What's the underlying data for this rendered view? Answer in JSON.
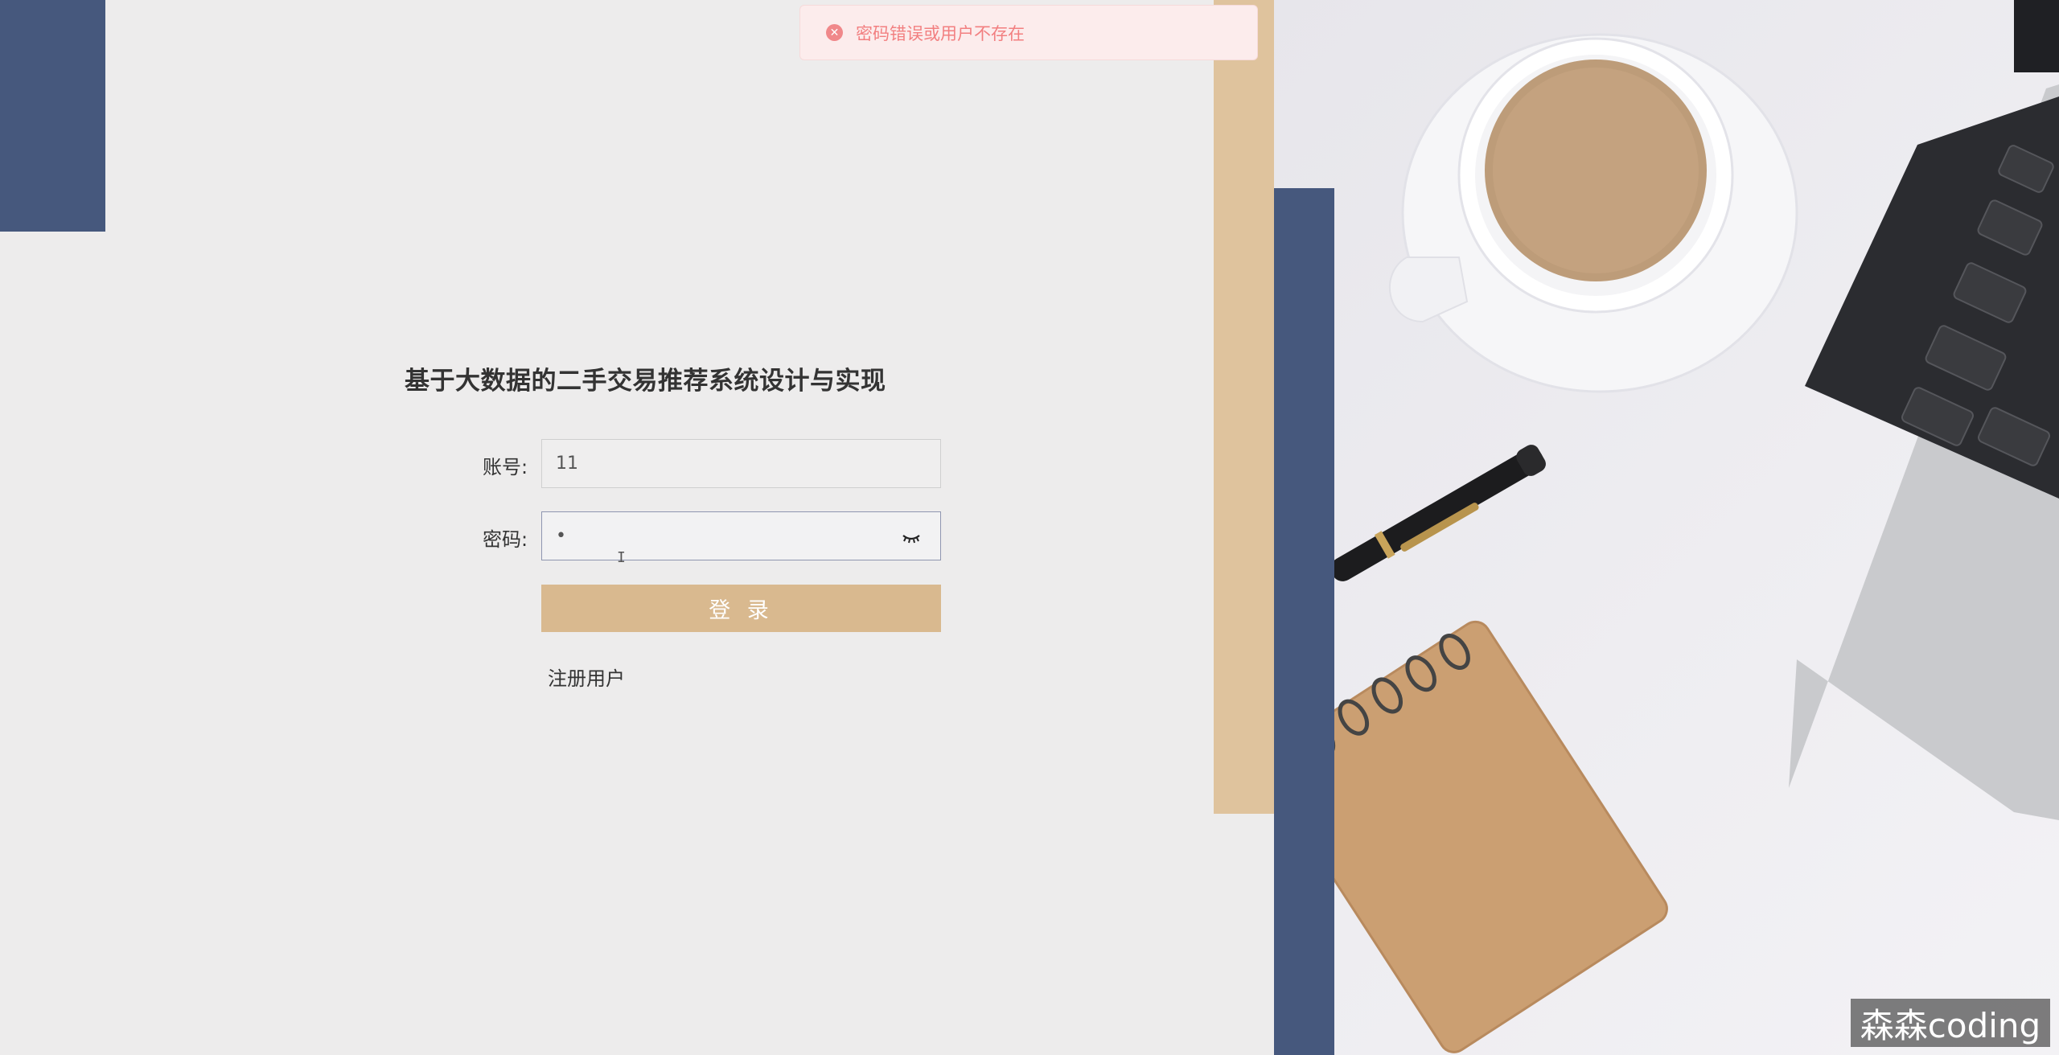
{
  "toast": {
    "message": "密码错误或用户不存在",
    "icon": "error-circle-icon",
    "color": "#f27f80"
  },
  "login": {
    "title": "基于大数据的二手交易推荐系统设计与实现",
    "username_label": "账号:",
    "username_value": "11",
    "password_label": "密码:",
    "password_value": "•",
    "login_button": "登 录",
    "register_link": "注册用户"
  },
  "watermark": {
    "text": "森森coding"
  },
  "colors": {
    "navy": "#46587d",
    "tan": "#dfc39d",
    "button": "#d9b98f",
    "background": "#edecec"
  },
  "photo": {
    "subject": "coffee cup, pen, notebook and laptop on desk"
  }
}
